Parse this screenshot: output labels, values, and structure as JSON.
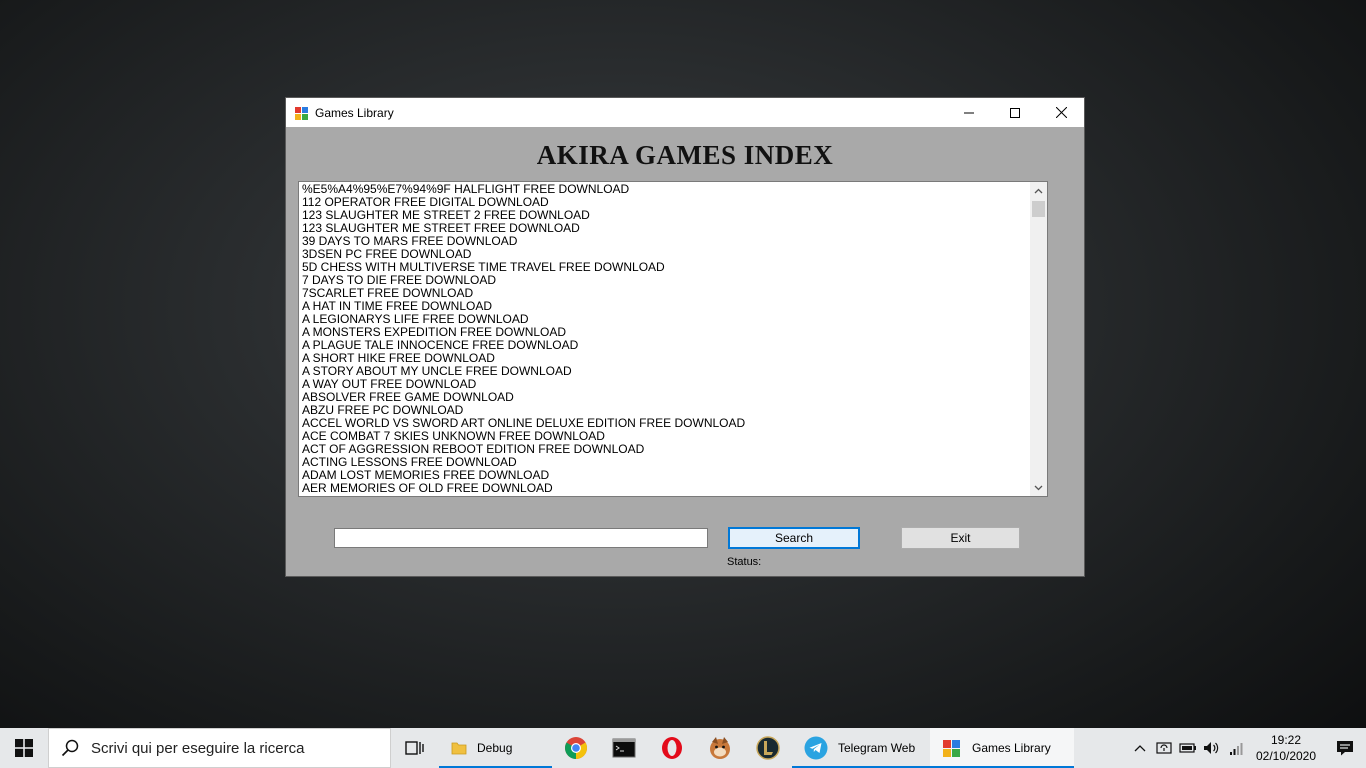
{
  "window": {
    "title": "Games Library",
    "heading": "AKIRA GAMES INDEX"
  },
  "list": {
    "items": [
      "%E5%A4%95%E7%94%9F HALFLIGHT FREE DOWNLOAD",
      "112 OPERATOR FREE DIGITAL DOWNLOAD",
      "123 SLAUGHTER ME STREET 2 FREE DOWNLOAD",
      "123 SLAUGHTER ME STREET FREE DOWNLOAD",
      "39 DAYS TO MARS FREE DOWNLOAD",
      "3DSEN PC FREE DOWNLOAD",
      "5D CHESS WITH MULTIVERSE TIME TRAVEL FREE DOWNLOAD",
      "7 DAYS TO DIE FREE DOWNLOAD",
      "7SCARLET FREE DOWNLOAD",
      "A HAT IN TIME FREE DOWNLOAD",
      "A LEGIONARYS LIFE FREE DOWNLOAD",
      "A MONSTERS EXPEDITION FREE DOWNLOAD",
      "A PLAGUE TALE INNOCENCE FREE DOWNLOAD",
      "A SHORT HIKE FREE DOWNLOAD",
      "A STORY ABOUT MY UNCLE FREE DOWNLOAD",
      "A WAY OUT FREE DOWNLOAD",
      "ABSOLVER FREE GAME DOWNLOAD",
      "ABZU FREE PC DOWNLOAD",
      "ACCEL WORLD VS SWORD ART ONLINE DELUXE EDITION FREE DOWNLOAD",
      "ACE COMBAT 7 SKIES UNKNOWN FREE DOWNLOAD",
      "ACT OF AGGRESSION REBOOT EDITION FREE DOWNLOAD",
      "ACTING LESSONS FREE DOWNLOAD",
      "ADAM LOST MEMORIES FREE DOWNLOAD",
      "AER MEMORIES OF OLD FREE DOWNLOAD"
    ]
  },
  "search": {
    "value": "",
    "button_label": "Search"
  },
  "exit_label": "Exit",
  "status_label": "Status:",
  "taskbar": {
    "search_placeholder": "Scrivi qui per eseguire la ricerca",
    "apps": {
      "debug": "Debug",
      "telegram": "Telegram Web",
      "games": "Games Library"
    },
    "time": "19:22",
    "date": "02/10/2020"
  },
  "colors": {
    "window_bg": "#a9a9a9",
    "accent": "#0078d7",
    "taskbar_bg": "#e6e8ea"
  }
}
